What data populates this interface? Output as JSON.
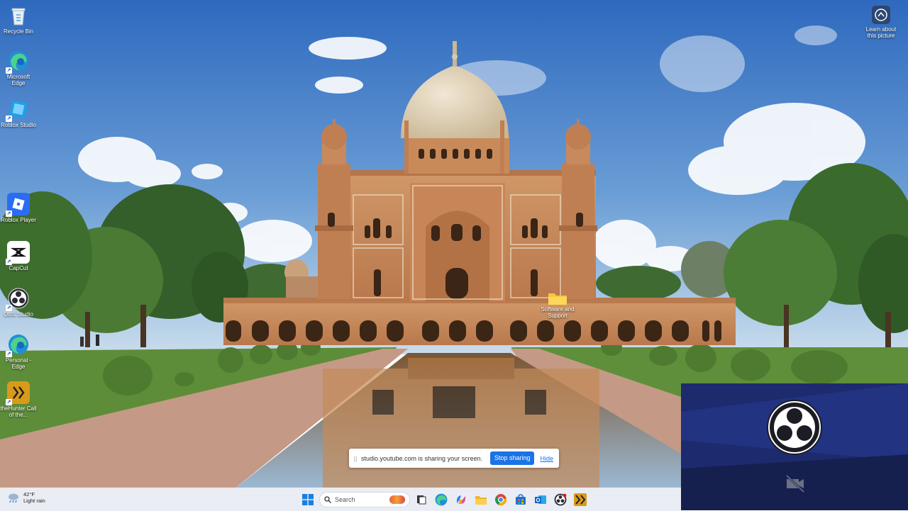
{
  "desktop": {
    "icons": [
      {
        "label": "Recycle Bin",
        "icon": "recycle-bin-icon"
      },
      {
        "label": "Microsoft Edge",
        "icon": "edge-icon"
      },
      {
        "label": "Roblox Studio",
        "icon": "roblox-studio-icon"
      },
      {
        "label": "Roblox Player",
        "icon": "roblox-player-icon"
      },
      {
        "label": "CapCut",
        "icon": "capcut-icon"
      },
      {
        "label": "OBS Studio",
        "icon": "obs-icon"
      },
      {
        "label": "Personal - Edge",
        "icon": "edge-personal-icon"
      },
      {
        "label": "theHunter Call of the...",
        "icon": "thehunter-icon"
      }
    ],
    "learn_label": "Learn about this picture",
    "folder_label": "Software and Support"
  },
  "share_bar": {
    "grip": "||",
    "message": "studio.youtube.com is sharing your screen.",
    "stop_label": "Stop sharing",
    "hide_label": "Hide"
  },
  "taskbar": {
    "weather_temp": "42°F",
    "weather_desc": "Light rain",
    "search_placeholder": "Search",
    "apps": [
      "start-icon",
      "task-view-icon",
      "edge-icon",
      "copilot-icon",
      "file-explorer-icon",
      "chrome-icon",
      "store-icon",
      "outlook-icon",
      "obs-icon",
      "thehunter-icon"
    ]
  },
  "colors": {
    "sky_top": "#2f6fc4",
    "sky_bottom": "#a9c8e8",
    "sandstone": "#c98a5a",
    "dome": "#e6d8c0",
    "grass": "#5f8f3a",
    "obs_panel": "#1e2a6e",
    "accent": "#1a73e8"
  }
}
